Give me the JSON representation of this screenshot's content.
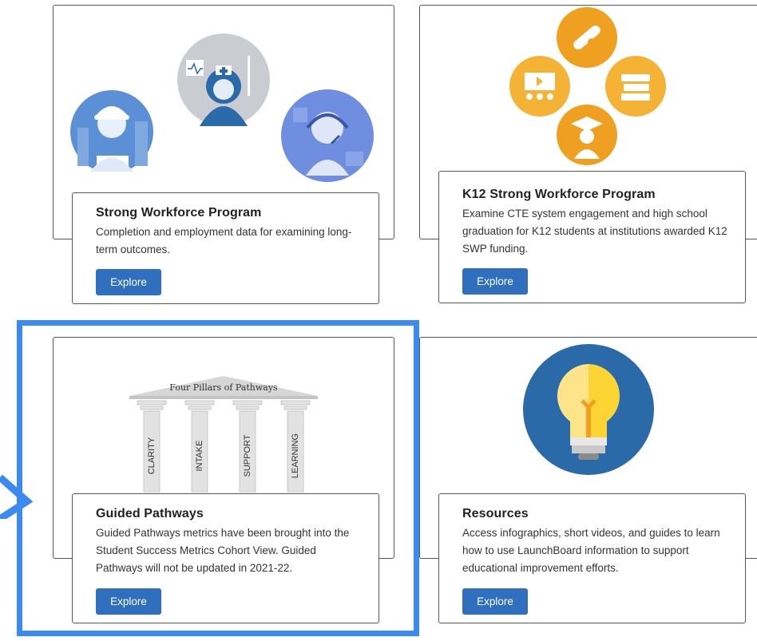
{
  "cards": [
    {
      "title": "Strong Workforce Program",
      "description": "Completion and employment data for examining long-term outcomes.",
      "button": "Explore",
      "image_icons": [
        "construction-worker-icon",
        "nurse-icon",
        "call-center-agent-icon"
      ]
    },
    {
      "title": "K12 Strong Workforce Program",
      "description": "Examine CTE system engagement and high school graduation for K12 students at institutions awarded K12 SWP funding.",
      "button": "Explore",
      "image_icons": [
        "diploma-icon",
        "classroom-video-icon",
        "books-icon",
        "graduate-icon"
      ]
    },
    {
      "title": "Guided Pathways",
      "description": "Guided Pathways metrics have been brought into the Student Success Metrics Cohort View. Guided Pathways will not be updated in 2021-22.",
      "button": "Explore",
      "pillars_heading": "Four Pillars of Pathways",
      "pillars": [
        "CLARITY",
        "INTAKE",
        "SUPPORT",
        "LEARNING"
      ]
    },
    {
      "title": "Resources",
      "description": "Access infographics, short videos, and guides to learn how to use LaunchBoard information to support educational improvement efforts.",
      "button": "Explore",
      "image_icons": [
        "lightbulb-icon"
      ]
    }
  ],
  "colors": {
    "button": "#2f6fbd",
    "highlight": "#3b8af0",
    "icon_orange": "#f0a020",
    "icon_blue": "#2b6aa8",
    "bulb_yellow": "#fcd535"
  }
}
